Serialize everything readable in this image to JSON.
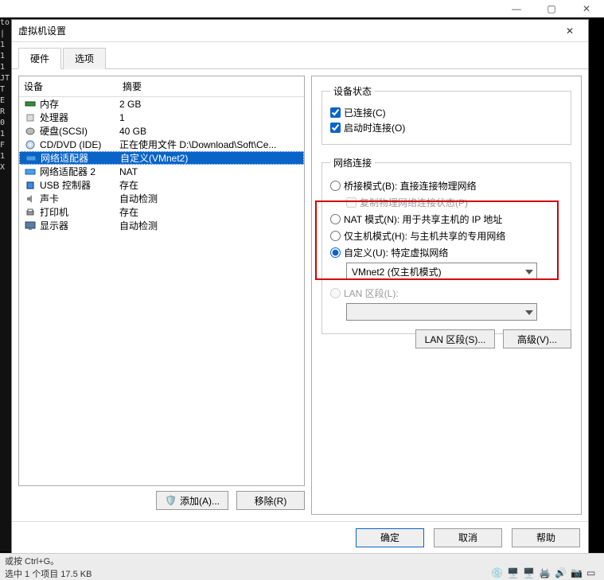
{
  "outerWindow": {
    "minimize": "—",
    "maximize": "▢",
    "close": "✕"
  },
  "bgLeft": "to\n|\n1\n1\n1\nJT\nT\nE\nR\n0\n1\nF\n1\nX",
  "dialog": {
    "title": "虚拟机设置",
    "closeGlyph": "✕",
    "tabs": {
      "hardware": "硬件",
      "options": "选项"
    },
    "hwHeader": {
      "device": "设备",
      "summary": "摘要"
    },
    "hwRows": [
      {
        "icon": "mem",
        "name": "内存",
        "summary": "2 GB"
      },
      {
        "icon": "cpu",
        "name": "处理器",
        "summary": "1"
      },
      {
        "icon": "disk",
        "name": "硬盘(SCSI)",
        "summary": "40 GB"
      },
      {
        "icon": "cd",
        "name": "CD/DVD (IDE)",
        "summary": "正在使用文件 D:\\Download\\Soft\\Ce..."
      },
      {
        "icon": "net",
        "name": "网络适配器",
        "summary": "自定义(VMnet2)",
        "selected": true
      },
      {
        "icon": "net",
        "name": "网络适配器 2",
        "summary": "NAT"
      },
      {
        "icon": "usb",
        "name": "USB 控制器",
        "summary": "存在"
      },
      {
        "icon": "sound",
        "name": "声卡",
        "summary": "自动检测"
      },
      {
        "icon": "printer",
        "name": "打印机",
        "summary": "存在"
      },
      {
        "icon": "display",
        "name": "显示器",
        "summary": "自动检测"
      }
    ],
    "leftButtons": {
      "add": "添加(A)...",
      "remove": "移除(R)"
    },
    "right": {
      "deviceStatus": {
        "legend": "设备状态",
        "connected": "已连接(C)",
        "connectAtPowerOn": "启动时连接(O)"
      },
      "netConn": {
        "legend": "网络连接",
        "bridged": "桥接模式(B): 直接连接物理网络",
        "replicate": "复制物理网络连接状态(P)",
        "nat": "NAT 模式(N): 用于共享主机的 IP 地址",
        "hostOnly": "仅主机模式(H): 与主机共享的专用网络",
        "custom": "自定义(U): 特定虚拟网络",
        "customValue": "VMnet2 (仅主机模式)",
        "lanSegment": "LAN 区段(L):",
        "lanValue": ""
      },
      "buttons": {
        "lanSegments": "LAN 区段(S)...",
        "advanced": "高级(V)..."
      }
    },
    "footer": {
      "ok": "确定",
      "cancel": "取消",
      "help": "帮助"
    }
  },
  "statusbar": {
    "line1": "或按 Ctrl+G。",
    "line2": "选中 1 个项目   17.5 KB"
  }
}
